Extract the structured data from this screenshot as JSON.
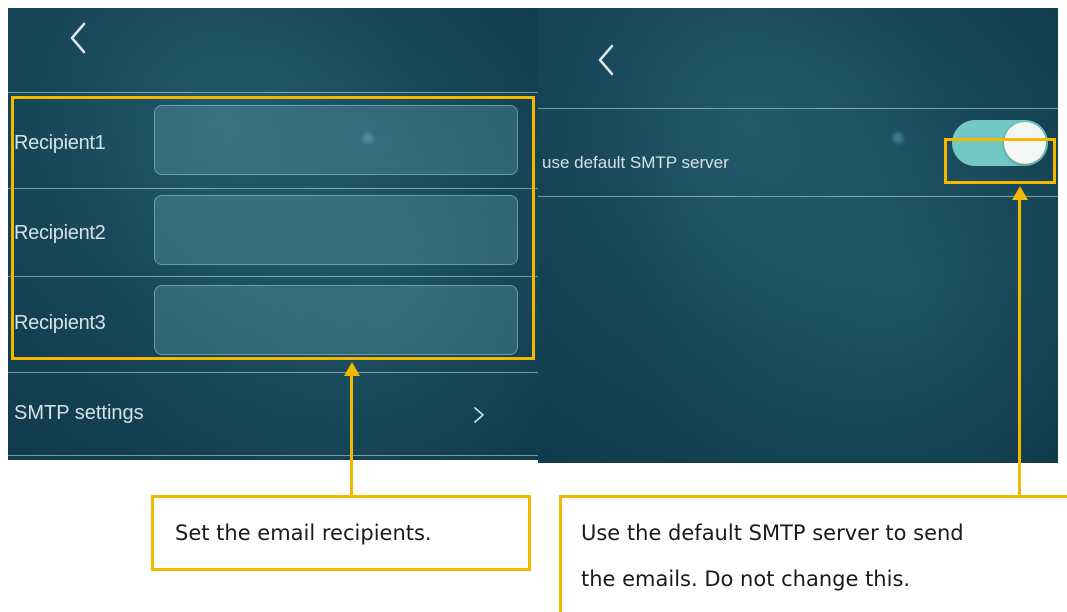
{
  "left_screen": {
    "back_icon": "chevron-left-icon",
    "recipients": [
      {
        "label": "Recipient1",
        "value": ""
      },
      {
        "label": "Recipient2",
        "value": ""
      },
      {
        "label": "Recipient3",
        "value": ""
      }
    ],
    "smtp_settings_label": "SMTP settings",
    "smtp_settings_chevron": ">"
  },
  "right_screen": {
    "back_icon": "chevron-left-icon",
    "default_smtp_label": "use default SMTP server",
    "default_smtp_enabled": true
  },
  "callouts": {
    "recipients_note": "Set the email recipients.",
    "smtp_note_line1": "Use the default SMTP server to send",
    "smtp_note_line2": "the emails. Do not change this."
  },
  "colors": {
    "highlight": "#f5b800",
    "toggle_on": "#72c9c4",
    "screen_bg": "#164556"
  }
}
